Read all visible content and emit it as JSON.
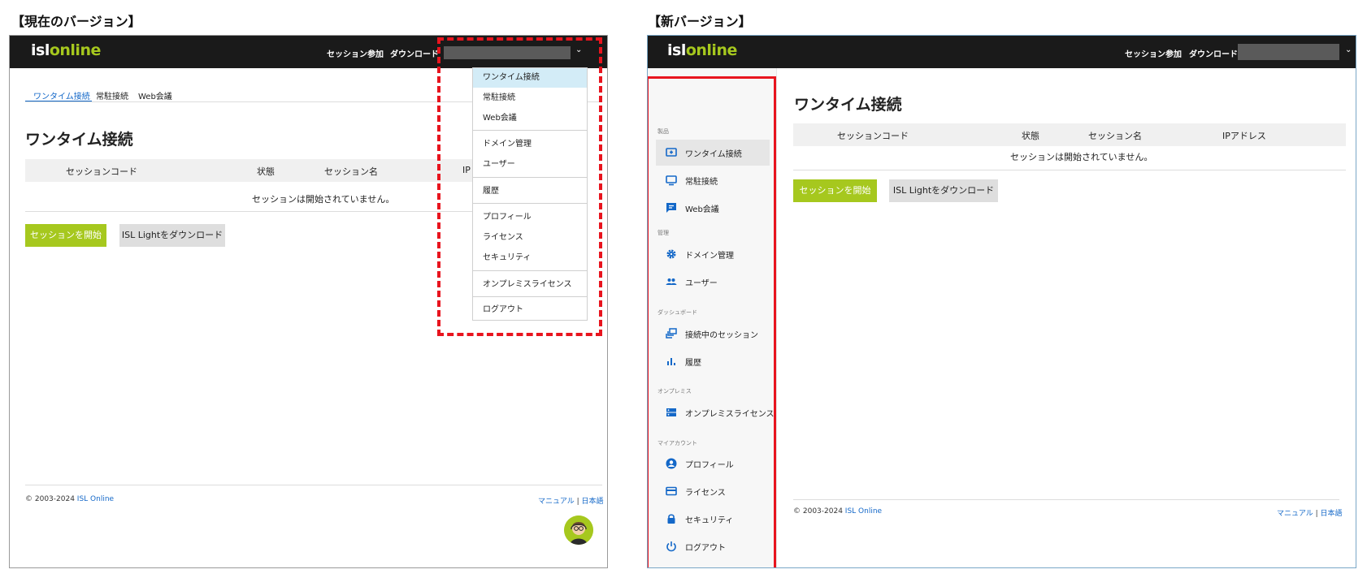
{
  "captions": {
    "current": "【現在のバージョン】",
    "new": "【新バージョン】"
  },
  "brand": {
    "logo_isl": "isl",
    "logo_online": "online"
  },
  "colors": {
    "accent": "#a6c81e",
    "topbar": "#1a1a1a",
    "link": "#1468c8",
    "highlight": "#e8141e"
  },
  "current": {
    "topnav": {
      "join": "セッション参加",
      "download": "ダウンロード"
    },
    "tabs": [
      {
        "label": "ワンタイム接続",
        "active": true
      },
      {
        "label": "常駐接続"
      },
      {
        "label": "Web会議"
      }
    ],
    "page_title": "ワンタイム接続",
    "table": {
      "columns": [
        "セッションコード",
        "状態",
        "セッション名",
        "IP"
      ],
      "empty_message": "セッションは開始されていません。"
    },
    "buttons": {
      "start": "セッションを開始",
      "download": "ISL Lightをダウンロード"
    },
    "menu_items": [
      {
        "label": "ワンタイム接続",
        "active": true
      },
      {
        "label": "常駐接続"
      },
      {
        "label": "Web会議"
      },
      {
        "label": "ドメイン管理"
      },
      {
        "label": "ユーザー"
      },
      {
        "label": "履歴"
      },
      {
        "label": "プロフィール"
      },
      {
        "label": "ライセンス"
      },
      {
        "label": "セキュリティ"
      },
      {
        "label": "オンプレミスライセンス"
      },
      {
        "label": "ログアウト"
      }
    ],
    "footer": {
      "copyright": "© 2003-2024",
      "company": "ISL Online",
      "manual": "マニュアル",
      "separator": "|",
      "language": "日本語"
    }
  },
  "new": {
    "topnav": {
      "join": "セッション参加",
      "download": "ダウンロード"
    },
    "sidebar": {
      "groups": [
        {
          "label": "製品",
          "items": [
            {
              "label": "ワンタイム接続",
              "icon": "screen-share-icon",
              "active": true
            },
            {
              "label": "常駐接続",
              "icon": "monitor-icon"
            },
            {
              "label": "Web会議",
              "icon": "chat-icon"
            }
          ]
        },
        {
          "label": "管理",
          "items": [
            {
              "label": "ドメイン管理",
              "icon": "gear-icon"
            },
            {
              "label": "ユーザー",
              "icon": "people-icon"
            }
          ]
        },
        {
          "label": "ダッシュボード",
          "items": [
            {
              "label": "接続中のセッション",
              "icon": "sessions-icon"
            },
            {
              "label": "履歴",
              "icon": "bar-chart-icon"
            }
          ]
        },
        {
          "label": "オンプレミス",
          "items": [
            {
              "label": "オンプレミスライセンス",
              "icon": "server-icon"
            }
          ]
        },
        {
          "label": "マイアカウント",
          "items": [
            {
              "label": "プロフィール",
              "icon": "account-icon"
            },
            {
              "label": "ライセンス",
              "icon": "card-icon"
            },
            {
              "label": "セキュリティ",
              "icon": "lock-icon"
            },
            {
              "label": "ログアウト",
              "icon": "power-icon"
            }
          ]
        }
      ],
      "collapse": "«"
    },
    "page_title": "ワンタイム接続",
    "table": {
      "columns": [
        "セッションコード",
        "状態",
        "セッション名",
        "IPアドレス"
      ],
      "empty_message": "セッションは開始されていません。"
    },
    "buttons": {
      "start": "セッションを開始",
      "download": "ISL Lightをダウンロード"
    },
    "footer": {
      "copyright": "© 2003-2024",
      "company": "ISL Online",
      "manual": "マニュアル",
      "separator": "|",
      "language": "日本語"
    }
  }
}
